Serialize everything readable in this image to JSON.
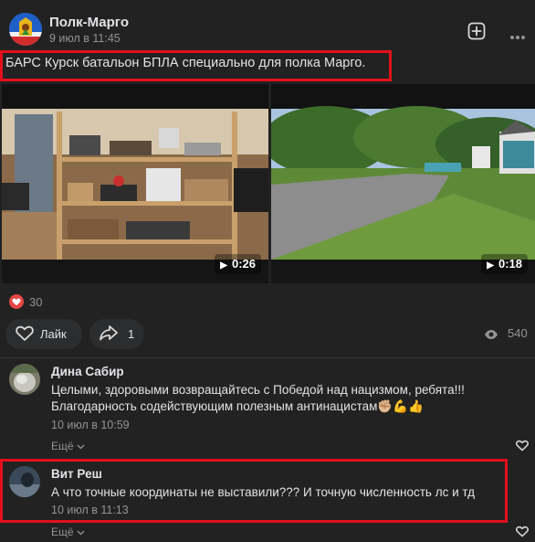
{
  "post": {
    "author": "Полк-Марго",
    "date": "9 июл в 11:45",
    "text": "БАРС Курск батальон БПЛА специально для полка Марго.",
    "media": [
      {
        "kind": "video",
        "duration": "0:26",
        "subject": "shelves with equipment"
      },
      {
        "kind": "video",
        "duration": "0:18",
        "subject": "road through a camp with trees"
      }
    ],
    "reactions_count": "30",
    "actions": {
      "like_label": "Лайк",
      "share_count": "1"
    },
    "views": "540"
  },
  "comments": [
    {
      "author": "Дина Сабир",
      "text_line1": "Целыми, здоровыми возвращайтесь с Победой над нацизмом, ребята!!!",
      "text_line2": "Благодарность содействующим полезным антинацистам✊🏼💪👍",
      "date": "10 июл в 10:59",
      "more_label": "Ещё"
    },
    {
      "author": "Вит Реш",
      "text_line1": "А что точные координаты не выставили??? И точную численность лс и тд",
      "date": "10 июл в 11:13",
      "more_label": "Ещё"
    }
  ],
  "colors": {
    "background": "#222222",
    "highlight_box": "#e3101b",
    "heart": "#e64646"
  },
  "icons": [
    "plus-square-icon",
    "more-dots-icon",
    "play-icon",
    "heart-icon",
    "share-icon",
    "eye-icon"
  ]
}
